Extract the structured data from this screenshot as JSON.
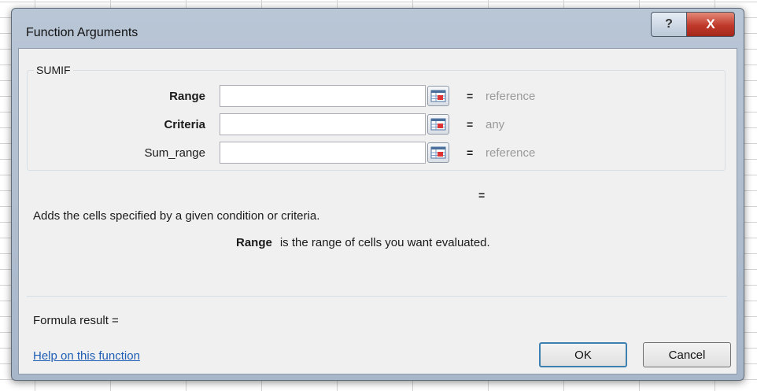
{
  "window": {
    "title": "Function Arguments",
    "help_glyph": "?",
    "close_glyph": "X"
  },
  "function": {
    "name": "SUMIF",
    "arguments": [
      {
        "label": "Range",
        "value": "",
        "result": "reference",
        "bold": true
      },
      {
        "label": "Criteria",
        "value": "",
        "result": "any",
        "bold": true
      },
      {
        "label": "Sum_range",
        "value": "",
        "result": "reference",
        "bold": false
      }
    ],
    "equals": "=",
    "result_equals": "=",
    "description": "Adds the cells specified by a given condition or criteria.",
    "arg_desc_name": "Range",
    "arg_desc_text": "is the range of cells you want evaluated."
  },
  "formula_result_label": "Formula result =",
  "help_link": "Help on this function",
  "buttons": {
    "ok": "OK",
    "cancel": "Cancel"
  },
  "colors": {
    "link": "#1f5eb5",
    "close": "#c0392b",
    "ok_border": "#3c7fb1"
  }
}
